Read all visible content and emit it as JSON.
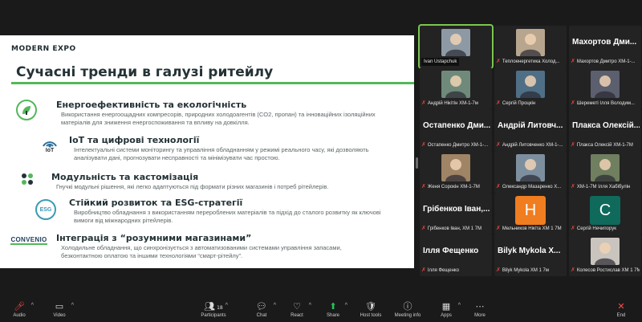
{
  "slide": {
    "logo": "MODERN EXPO",
    "title": "Сучасні тренди в галузі ритейлу",
    "bullets": [
      {
        "heading": "Енергоефективність та екологічність",
        "body": "Використання енергоощадних компресорів, природних холодоагентів (CO2, пропан) та інноваційних ізоляційних матеріалів для зниження енергоспоживання та впливу на довкілля.",
        "icon": "eco-plug-icon"
      },
      {
        "heading": "IoT та цифрові технології",
        "body": "Інтелектуальні системи моніторингу та управління обладнанням у режимі реального часу, які дозволяють аналізувати дані, прогнозувати несправності та мінімізувати час простою.",
        "icon": "iot-icon",
        "icon_text": "IoT"
      },
      {
        "heading": "Модульність та кастомізація",
        "body": "Гнучкі модульні рішення, які легко адаптуються під формати різних магазинів і потреб рітейлерів.",
        "icon": "modules-icon"
      },
      {
        "heading": "Стійкий розвиток та ESG-стратегії",
        "body": "Виробництво обладнання з використанням перероблених матеріалів та підхід до сталого розвитку як ключові вимоги від міжнародних рітейлерів.",
        "icon": "esg-icon",
        "icon_text": "ESG"
      },
      {
        "heading": "Інтеграція з “розумними магазинами”",
        "body": "Холодильне обладнання, що синхронізується з автоматизованими системами управління запасами, безконтактною оплатою та іншими технологіями “смарт-рітейлу”.",
        "icon": "convenio-logo",
        "icon_text": "CONVENIO"
      }
    ]
  },
  "participants": [
    {
      "type": "video",
      "caption": "Ivan Ustapchuk",
      "muted": false,
      "active": true,
      "photo": "#8d9aa5"
    },
    {
      "type": "video",
      "caption": "Теплоенергетика Холод...",
      "muted": true,
      "photo": "#b7a58e"
    },
    {
      "type": "name",
      "name": "Махортов Дми...",
      "caption": "Махортов Дмитро ХМ-1-...",
      "muted": true
    },
    {
      "type": "video",
      "caption": "Андрій Нікітін ХМ-1-7м",
      "muted": true,
      "photo": "#6f8a7b"
    },
    {
      "type": "video",
      "caption": "Сергій Процкін",
      "muted": true,
      "photo": "#4f6f86"
    },
    {
      "type": "video",
      "caption": "Шереметі Ілля Володим...",
      "muted": true,
      "photo": "#5b5f6e"
    },
    {
      "type": "name",
      "name": "Остапенко Дми...",
      "caption": "Остапенко Дмитро ХМ-1-...",
      "muted": true
    },
    {
      "type": "name",
      "name": "Андрій Литовч...",
      "caption": "Андрій Литовченко ХМ-1-...",
      "muted": true
    },
    {
      "type": "name",
      "name": "Плакса Олексій...",
      "caption": "Плакса Олексій ХМ-1-7М",
      "muted": true
    },
    {
      "type": "video",
      "caption": "Женя Сорокін ХМ-1-7М",
      "muted": true,
      "photo": "#a08466"
    },
    {
      "type": "video",
      "caption": "Олександр Мазаренко Х...",
      "muted": true,
      "photo": "#7d8f9e"
    },
    {
      "type": "video",
      "caption": "ХМ-1-7М Ілля Хабібулін",
      "muted": true,
      "photo": "#6f7f5f"
    },
    {
      "type": "name",
      "name": "Грібенков Іван,...",
      "caption": "Грібенков Іван, ХМ 1 7М",
      "muted": true
    },
    {
      "type": "letter",
      "letter": "Н",
      "color": "#f07d1f",
      "caption": "Мельников Нікіта ХМ 1 7М",
      "muted": true
    },
    {
      "type": "letter",
      "letter": "С",
      "color": "#0f6a5c",
      "caption": "Сергій Нечипорук",
      "muted": true
    },
    {
      "type": "name",
      "name": "Ілля Фещенко",
      "caption": "Ілля Фещенко",
      "muted": true
    },
    {
      "type": "name",
      "name": "Bilyk Mykola X...",
      "caption": "Bilyk Mykola ХМ 1 7м",
      "muted": true
    },
    {
      "type": "video",
      "caption": "Колесов Ростислав ХМ 1 7М",
      "muted": true,
      "photo": "#c9c4bd"
    }
  ],
  "toolbar": {
    "items": [
      {
        "label": "Audio",
        "icon": "microphone-muted-icon",
        "glyph": "🎤︎",
        "caret": true
      },
      {
        "label": "Video",
        "icon": "video-camera-icon",
        "glyph": "▭",
        "caret": true
      },
      {
        "label": "Participants",
        "icon": "participants-icon",
        "glyph": "👥︎",
        "badge": "18",
        "caret": true
      },
      {
        "label": "Chat",
        "icon": "chat-icon",
        "glyph": "💬︎",
        "caret": true
      },
      {
        "label": "React",
        "icon": "react-icon",
        "glyph": "♡",
        "caret": true
      },
      {
        "label": "Share",
        "icon": "share-screen-icon",
        "glyph": "⬆",
        "caret": true
      },
      {
        "label": "Host tools",
        "icon": "host-tools-icon",
        "glyph": "🛡︎",
        "caret": false
      },
      {
        "label": "Meeting info",
        "icon": "info-icon",
        "glyph": "ⓘ",
        "caret": false
      },
      {
        "label": "Apps",
        "icon": "apps-icon",
        "glyph": "▦",
        "caret": true
      },
      {
        "label": "More",
        "icon": "more-icon",
        "glyph": "⋯",
        "caret": false
      },
      {
        "label": "End",
        "icon": "end-call-icon",
        "glyph": "✕",
        "caret": false
      }
    ]
  },
  "colors": {
    "accent_green": "#53b85a",
    "muted_red": "#e0453b",
    "end_red": "#ff4d4d"
  }
}
